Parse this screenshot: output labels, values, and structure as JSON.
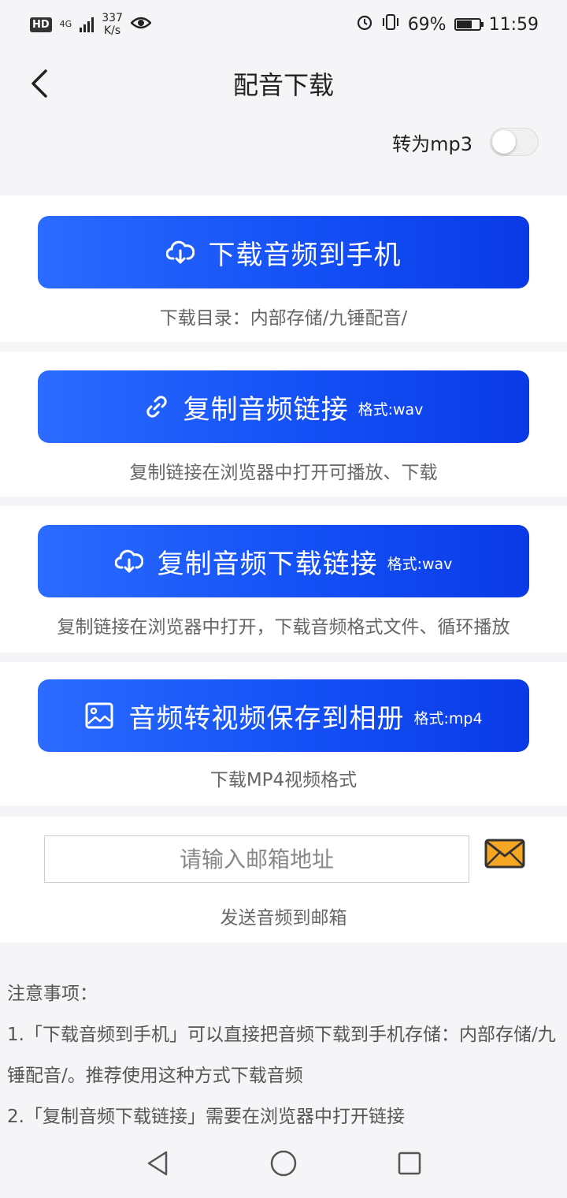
{
  "status_bar": {
    "hd": "HD",
    "network": "4G",
    "speed_value": "337",
    "speed_unit": "K/s",
    "battery": "69%",
    "time": "11:59"
  },
  "header": {
    "title": "配音下载"
  },
  "toggle": {
    "label": "转为mp3",
    "on": false
  },
  "actions": [
    {
      "label": "下载音频到手机",
      "format": "",
      "icon": "cloud-download-icon",
      "desc": "下载目录：内部存储/九锤配音/"
    },
    {
      "label": "复制音频链接",
      "format": "格式:wav",
      "icon": "link-icon",
      "desc": "复制链接在浏览器中打开可播放、下载"
    },
    {
      "label": "复制音频下载链接",
      "format": "格式:wav",
      "icon": "cloud-download-icon",
      "desc": "复制链接在浏览器中打开，下载音频格式文件、循环播放"
    },
    {
      "label": "音频转视频保存到相册",
      "format": "格式:mp4",
      "icon": "image-icon",
      "desc": "下载MP4视频格式"
    }
  ],
  "email": {
    "placeholder": "请输入邮箱地址",
    "desc": "发送音频到邮箱"
  },
  "notes": {
    "title": "注意事项：",
    "line1": "1.「下载音频到手机」可以直接把音频下载到手机存储：内部存储/九锤配音/。推荐使用这种方式下载音频",
    "line2": "2.「复制音频下载链接」需要在浏览器中打开链接"
  },
  "colors": {
    "button_start": "#2b6bff",
    "button_end": "#0a3ae6",
    "mail_icon": "#f5a623"
  }
}
